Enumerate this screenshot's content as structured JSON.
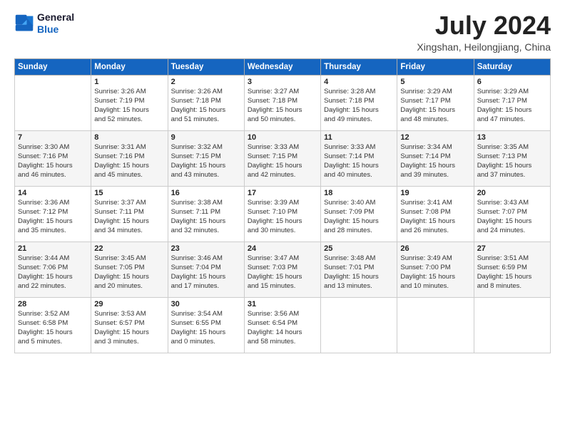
{
  "header": {
    "logo_line1": "General",
    "logo_line2": "Blue",
    "month_title": "July 2024",
    "location": "Xingshan, Heilongjiang, China"
  },
  "weekdays": [
    "Sunday",
    "Monday",
    "Tuesday",
    "Wednesday",
    "Thursday",
    "Friday",
    "Saturday"
  ],
  "weeks": [
    [
      {
        "day": "",
        "detail": ""
      },
      {
        "day": "1",
        "detail": "Sunrise: 3:26 AM\nSunset: 7:19 PM\nDaylight: 15 hours\nand 52 minutes."
      },
      {
        "day": "2",
        "detail": "Sunrise: 3:26 AM\nSunset: 7:18 PM\nDaylight: 15 hours\nand 51 minutes."
      },
      {
        "day": "3",
        "detail": "Sunrise: 3:27 AM\nSunset: 7:18 PM\nDaylight: 15 hours\nand 50 minutes."
      },
      {
        "day": "4",
        "detail": "Sunrise: 3:28 AM\nSunset: 7:18 PM\nDaylight: 15 hours\nand 49 minutes."
      },
      {
        "day": "5",
        "detail": "Sunrise: 3:29 AM\nSunset: 7:17 PM\nDaylight: 15 hours\nand 48 minutes."
      },
      {
        "day": "6",
        "detail": "Sunrise: 3:29 AM\nSunset: 7:17 PM\nDaylight: 15 hours\nand 47 minutes."
      }
    ],
    [
      {
        "day": "7",
        "detail": "Sunrise: 3:30 AM\nSunset: 7:16 PM\nDaylight: 15 hours\nand 46 minutes."
      },
      {
        "day": "8",
        "detail": "Sunrise: 3:31 AM\nSunset: 7:16 PM\nDaylight: 15 hours\nand 45 minutes."
      },
      {
        "day": "9",
        "detail": "Sunrise: 3:32 AM\nSunset: 7:15 PM\nDaylight: 15 hours\nand 43 minutes."
      },
      {
        "day": "10",
        "detail": "Sunrise: 3:33 AM\nSunset: 7:15 PM\nDaylight: 15 hours\nand 42 minutes."
      },
      {
        "day": "11",
        "detail": "Sunrise: 3:33 AM\nSunset: 7:14 PM\nDaylight: 15 hours\nand 40 minutes."
      },
      {
        "day": "12",
        "detail": "Sunrise: 3:34 AM\nSunset: 7:14 PM\nDaylight: 15 hours\nand 39 minutes."
      },
      {
        "day": "13",
        "detail": "Sunrise: 3:35 AM\nSunset: 7:13 PM\nDaylight: 15 hours\nand 37 minutes."
      }
    ],
    [
      {
        "day": "14",
        "detail": "Sunrise: 3:36 AM\nSunset: 7:12 PM\nDaylight: 15 hours\nand 35 minutes."
      },
      {
        "day": "15",
        "detail": "Sunrise: 3:37 AM\nSunset: 7:11 PM\nDaylight: 15 hours\nand 34 minutes."
      },
      {
        "day": "16",
        "detail": "Sunrise: 3:38 AM\nSunset: 7:11 PM\nDaylight: 15 hours\nand 32 minutes."
      },
      {
        "day": "17",
        "detail": "Sunrise: 3:39 AM\nSunset: 7:10 PM\nDaylight: 15 hours\nand 30 minutes."
      },
      {
        "day": "18",
        "detail": "Sunrise: 3:40 AM\nSunset: 7:09 PM\nDaylight: 15 hours\nand 28 minutes."
      },
      {
        "day": "19",
        "detail": "Sunrise: 3:41 AM\nSunset: 7:08 PM\nDaylight: 15 hours\nand 26 minutes."
      },
      {
        "day": "20",
        "detail": "Sunrise: 3:43 AM\nSunset: 7:07 PM\nDaylight: 15 hours\nand 24 minutes."
      }
    ],
    [
      {
        "day": "21",
        "detail": "Sunrise: 3:44 AM\nSunset: 7:06 PM\nDaylight: 15 hours\nand 22 minutes."
      },
      {
        "day": "22",
        "detail": "Sunrise: 3:45 AM\nSunset: 7:05 PM\nDaylight: 15 hours\nand 20 minutes."
      },
      {
        "day": "23",
        "detail": "Sunrise: 3:46 AM\nSunset: 7:04 PM\nDaylight: 15 hours\nand 17 minutes."
      },
      {
        "day": "24",
        "detail": "Sunrise: 3:47 AM\nSunset: 7:03 PM\nDaylight: 15 hours\nand 15 minutes."
      },
      {
        "day": "25",
        "detail": "Sunrise: 3:48 AM\nSunset: 7:01 PM\nDaylight: 15 hours\nand 13 minutes."
      },
      {
        "day": "26",
        "detail": "Sunrise: 3:49 AM\nSunset: 7:00 PM\nDaylight: 15 hours\nand 10 minutes."
      },
      {
        "day": "27",
        "detail": "Sunrise: 3:51 AM\nSunset: 6:59 PM\nDaylight: 15 hours\nand 8 minutes."
      }
    ],
    [
      {
        "day": "28",
        "detail": "Sunrise: 3:52 AM\nSunset: 6:58 PM\nDaylight: 15 hours\nand 5 minutes."
      },
      {
        "day": "29",
        "detail": "Sunrise: 3:53 AM\nSunset: 6:57 PM\nDaylight: 15 hours\nand 3 minutes."
      },
      {
        "day": "30",
        "detail": "Sunrise: 3:54 AM\nSunset: 6:55 PM\nDaylight: 15 hours\nand 0 minutes."
      },
      {
        "day": "31",
        "detail": "Sunrise: 3:56 AM\nSunset: 6:54 PM\nDaylight: 14 hours\nand 58 minutes."
      },
      {
        "day": "",
        "detail": ""
      },
      {
        "day": "",
        "detail": ""
      },
      {
        "day": "",
        "detail": ""
      }
    ]
  ]
}
